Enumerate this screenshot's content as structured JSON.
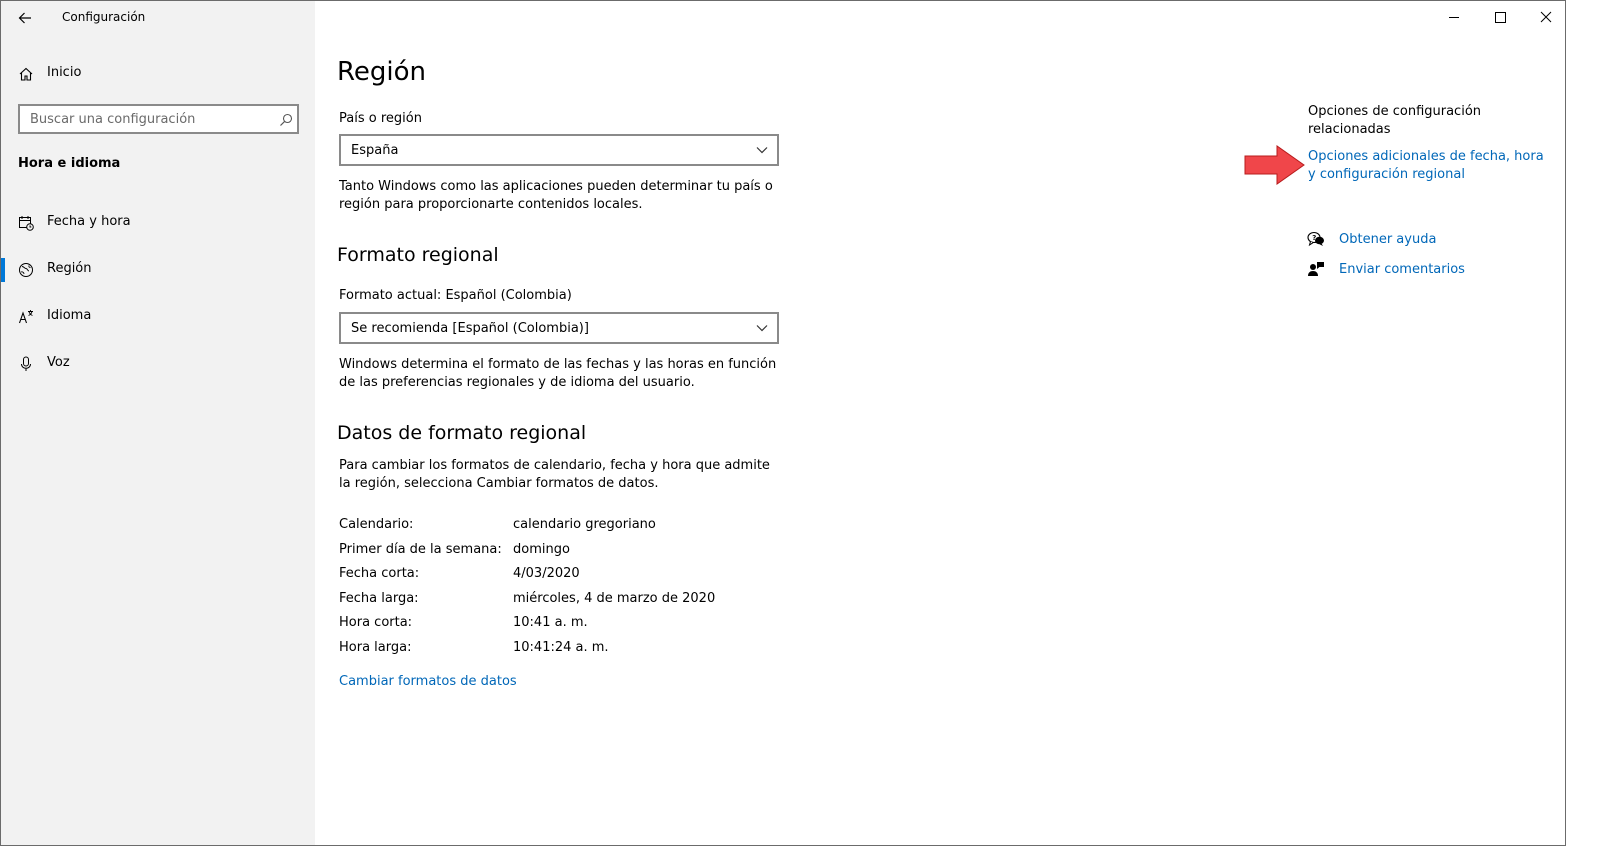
{
  "window": {
    "title": "Configuración",
    "back_icon": "arrow-left-icon",
    "controls": [
      "minimize-icon",
      "maximize-icon",
      "close-icon"
    ]
  },
  "sidebar": {
    "home_label": "Inicio",
    "search_placeholder": "Buscar una configuración",
    "section_title": "Hora e idioma",
    "items": [
      {
        "label": "Fecha y hora",
        "icon": "calendar-clock-icon",
        "selected": false
      },
      {
        "label": "Región",
        "icon": "globe-region-icon",
        "selected": true
      },
      {
        "label": "Idioma",
        "icon": "language-icon",
        "selected": false
      },
      {
        "label": "Voz",
        "icon": "microphone-icon",
        "selected": false
      }
    ]
  },
  "main": {
    "title": "Región",
    "country": {
      "label": "País o región",
      "value": "España",
      "description": "Tanto Windows como las aplicaciones pueden determinar tu país o región para proporcionarte contenidos locales."
    },
    "regional_format": {
      "heading": "Formato regional",
      "current_label": "Formato actual: Español (Colombia)",
      "value": "Se recomienda [Español (Colombia)]",
      "description": "Windows determina el formato de las fechas y las horas en función de las preferencias regionales y de idioma del usuario."
    },
    "format_data": {
      "heading": "Datos de formato regional",
      "description": "Para cambiar los formatos de calendario, fecha y hora que admite la región, selecciona Cambiar formatos de datos.",
      "rows": [
        {
          "label": "Calendario:",
          "value": "calendario gregoriano"
        },
        {
          "label": "Primer día de la semana:",
          "value": "domingo"
        },
        {
          "label": "Fecha corta:",
          "value": "4/03/2020"
        },
        {
          "label": "Fecha larga:",
          "value": "miércoles, 4 de marzo de 2020"
        },
        {
          "label": "Hora corta:",
          "value": "10:41 a. m."
        },
        {
          "label": "Hora larga:",
          "value": "10:41:24 a. m."
        }
      ],
      "change_link": "Cambiar formatos de datos"
    }
  },
  "related": {
    "heading": "Opciones de configuración relacionadas",
    "link": "Opciones adicionales de fecha, hora y configuración regional",
    "help": "Obtener ayuda",
    "feedback": "Enviar comentarios"
  },
  "colors": {
    "accent": "#0078d7",
    "link": "#0067b8",
    "arrow": "#f0464a",
    "sidebar_bg": "#f2f2f2"
  }
}
